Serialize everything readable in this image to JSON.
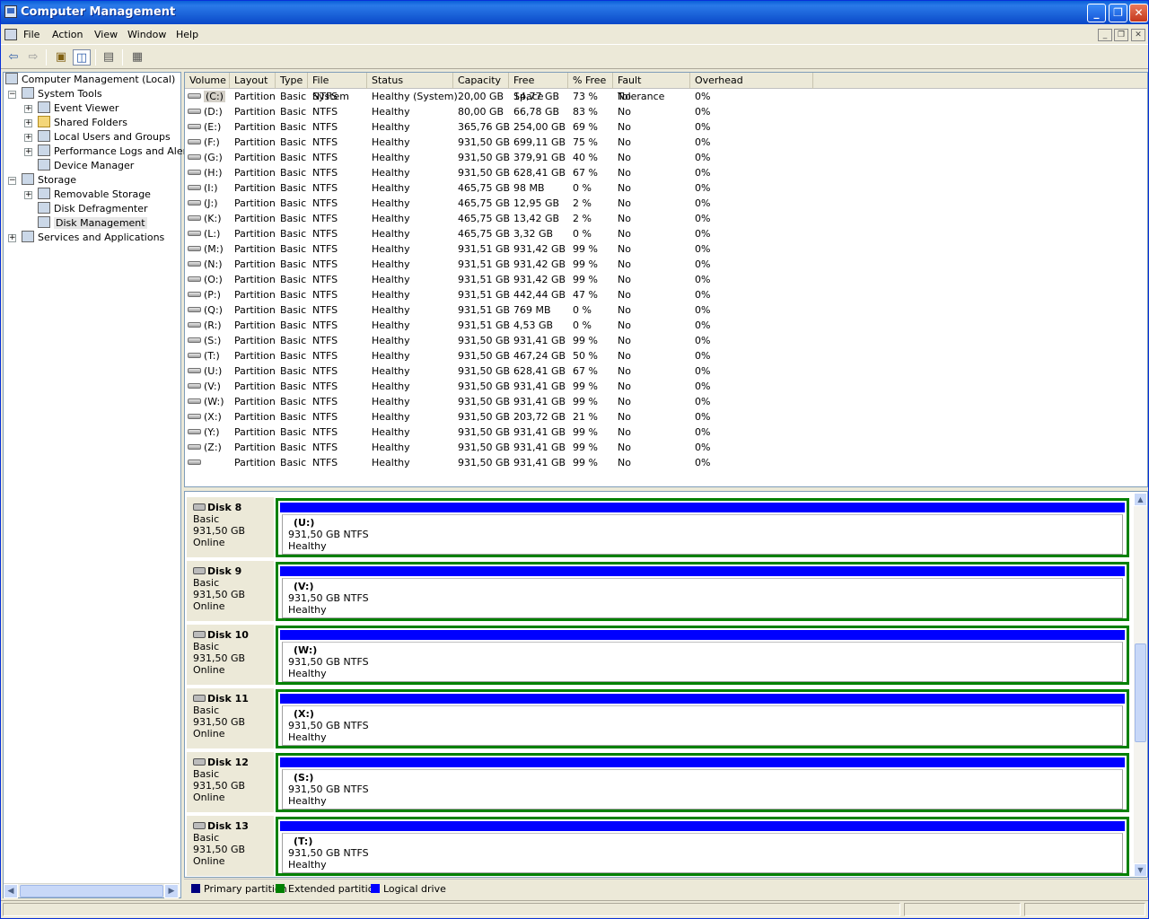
{
  "window": {
    "title": "Computer Management"
  },
  "menu": [
    "File",
    "Action",
    "View",
    "Window",
    "Help"
  ],
  "toolbar": {
    "icons": [
      "back-icon",
      "forward-icon",
      "up-folder-icon",
      "show-hide-tree-icon",
      "properties-icon",
      "help-icon"
    ]
  },
  "tree": [
    {
      "label": "Computer Management (Local)",
      "icon": "computer-icon"
    },
    {
      "label": "System Tools",
      "icon": "tools-icon"
    },
    {
      "label": "Event Viewer",
      "icon": "event-viewer-icon"
    },
    {
      "label": "Shared Folders",
      "icon": "folder-icon"
    },
    {
      "label": "Local Users and Groups",
      "icon": "users-icon"
    },
    {
      "label": "Performance Logs and Alerts",
      "icon": "performance-icon"
    },
    {
      "label": "Device Manager",
      "icon": "device-manager-icon"
    },
    {
      "label": "Storage",
      "icon": "storage-icon"
    },
    {
      "label": "Removable Storage",
      "icon": "removable-storage-icon"
    },
    {
      "label": "Disk Defragmenter",
      "icon": "defragmenter-icon"
    },
    {
      "label": "Disk Management",
      "icon": "disk-management-icon"
    },
    {
      "label": "Services and Applications",
      "icon": "services-icon"
    }
  ],
  "columns": [
    "Volume",
    "Layout",
    "Type",
    "File System",
    "Status",
    "Capacity",
    "Free Space",
    "% Free",
    "Fault Tolerance",
    "Overhead"
  ],
  "volumes": [
    [
      "(C:)",
      "Partition",
      "Basic",
      "NTFS",
      "Healthy (System)",
      "20,00 GB",
      "14,77 GB",
      "73 %",
      "No",
      "0%"
    ],
    [
      "(D:)",
      "Partition",
      "Basic",
      "NTFS",
      "Healthy",
      "80,00 GB",
      "66,78 GB",
      "83 %",
      "No",
      "0%"
    ],
    [
      "(E:)",
      "Partition",
      "Basic",
      "NTFS",
      "Healthy",
      "365,76 GB",
      "254,00 GB",
      "69 %",
      "No",
      "0%"
    ],
    [
      "(F:)",
      "Partition",
      "Basic",
      "NTFS",
      "Healthy",
      "931,50 GB",
      "699,11 GB",
      "75 %",
      "No",
      "0%"
    ],
    [
      "(G:)",
      "Partition",
      "Basic",
      "NTFS",
      "Healthy",
      "931,50 GB",
      "379,91 GB",
      "40 %",
      "No",
      "0%"
    ],
    [
      "(H:)",
      "Partition",
      "Basic",
      "NTFS",
      "Healthy",
      "931,50 GB",
      "628,41 GB",
      "67 %",
      "No",
      "0%"
    ],
    [
      "(I:)",
      "Partition",
      "Basic",
      "NTFS",
      "Healthy",
      "465,75 GB",
      "98 MB",
      "0 %",
      "No",
      "0%"
    ],
    [
      "(J:)",
      "Partition",
      "Basic",
      "NTFS",
      "Healthy",
      "465,75 GB",
      "12,95 GB",
      "2 %",
      "No",
      "0%"
    ],
    [
      "(K:)",
      "Partition",
      "Basic",
      "NTFS",
      "Healthy",
      "465,75 GB",
      "13,42 GB",
      "2 %",
      "No",
      "0%"
    ],
    [
      "(L:)",
      "Partition",
      "Basic",
      "NTFS",
      "Healthy",
      "465,75 GB",
      "3,32 GB",
      "0 %",
      "No",
      "0%"
    ],
    [
      "(M:)",
      "Partition",
      "Basic",
      "NTFS",
      "Healthy",
      "931,51 GB",
      "931,42 GB",
      "99 %",
      "No",
      "0%"
    ],
    [
      "(N:)",
      "Partition",
      "Basic",
      "NTFS",
      "Healthy",
      "931,51 GB",
      "931,42 GB",
      "99 %",
      "No",
      "0%"
    ],
    [
      "(O:)",
      "Partition",
      "Basic",
      "NTFS",
      "Healthy",
      "931,51 GB",
      "931,42 GB",
      "99 %",
      "No",
      "0%"
    ],
    [
      "(P:)",
      "Partition",
      "Basic",
      "NTFS",
      "Healthy",
      "931,51 GB",
      "442,44 GB",
      "47 %",
      "No",
      "0%"
    ],
    [
      "(Q:)",
      "Partition",
      "Basic",
      "NTFS",
      "Healthy",
      "931,51 GB",
      "769 MB",
      "0 %",
      "No",
      "0%"
    ],
    [
      "(R:)",
      "Partition",
      "Basic",
      "NTFS",
      "Healthy",
      "931,51 GB",
      "4,53 GB",
      "0 %",
      "No",
      "0%"
    ],
    [
      "(S:)",
      "Partition",
      "Basic",
      "NTFS",
      "Healthy",
      "931,50 GB",
      "931,41 GB",
      "99 %",
      "No",
      "0%"
    ],
    [
      "(T:)",
      "Partition",
      "Basic",
      "NTFS",
      "Healthy",
      "931,50 GB",
      "467,24 GB",
      "50 %",
      "No",
      "0%"
    ],
    [
      "(U:)",
      "Partition",
      "Basic",
      "NTFS",
      "Healthy",
      "931,50 GB",
      "628,41 GB",
      "67 %",
      "No",
      "0%"
    ],
    [
      "(V:)",
      "Partition",
      "Basic",
      "NTFS",
      "Healthy",
      "931,50 GB",
      "931,41 GB",
      "99 %",
      "No",
      "0%"
    ],
    [
      "(W:)",
      "Partition",
      "Basic",
      "NTFS",
      "Healthy",
      "931,50 GB",
      "931,41 GB",
      "99 %",
      "No",
      "0%"
    ],
    [
      "(X:)",
      "Partition",
      "Basic",
      "NTFS",
      "Healthy",
      "931,50 GB",
      "203,72 GB",
      "21 %",
      "No",
      "0%"
    ],
    [
      "(Y:)",
      "Partition",
      "Basic",
      "NTFS",
      "Healthy",
      "931,50 GB",
      "931,41 GB",
      "99 %",
      "No",
      "0%"
    ],
    [
      "(Z:)",
      "Partition",
      "Basic",
      "NTFS",
      "Healthy",
      "931,50 GB",
      "931,41 GB",
      "99 %",
      "No",
      "0%"
    ],
    [
      "",
      "Partition",
      "Basic",
      "NTFS",
      "Healthy",
      "931,50 GB",
      "931,41 GB",
      "99 %",
      "No",
      "0%"
    ]
  ],
  "disks": [
    {
      "name": "Disk 8",
      "type": "Basic",
      "size": "931,50 GB",
      "state": "Online",
      "volume": "(U:)",
      "details": "931,50 GB NTFS",
      "status": "Healthy"
    },
    {
      "name": "Disk 9",
      "type": "Basic",
      "size": "931,50 GB",
      "state": "Online",
      "volume": "(V:)",
      "details": "931,50 GB NTFS",
      "status": "Healthy"
    },
    {
      "name": "Disk 10",
      "type": "Basic",
      "size": "931,50 GB",
      "state": "Online",
      "volume": "(W:)",
      "details": "931,50 GB NTFS",
      "status": "Healthy"
    },
    {
      "name": "Disk 11",
      "type": "Basic",
      "size": "931,50 GB",
      "state": "Online",
      "volume": "(X:)",
      "details": "931,50 GB NTFS",
      "status": "Healthy"
    },
    {
      "name": "Disk 12",
      "type": "Basic",
      "size": "931,50 GB",
      "state": "Online",
      "volume": "(S:)",
      "details": "931,50 GB NTFS",
      "status": "Healthy"
    },
    {
      "name": "Disk 13",
      "type": "Basic",
      "size": "931,50 GB",
      "state": "Online",
      "volume": "(T:)",
      "details": "931,50 GB NTFS",
      "status": "Healthy"
    }
  ],
  "legend": [
    {
      "label": "Primary partition",
      "color": "#000080"
    },
    {
      "label": "Extended partition",
      "color": "#008000"
    },
    {
      "label": "Logical drive",
      "color": "#0000ff"
    }
  ],
  "colors": {
    "titlebar": "#0a5fd8",
    "selection": "#316ac5",
    "extended": "#008000",
    "logical": "#0000ff"
  }
}
